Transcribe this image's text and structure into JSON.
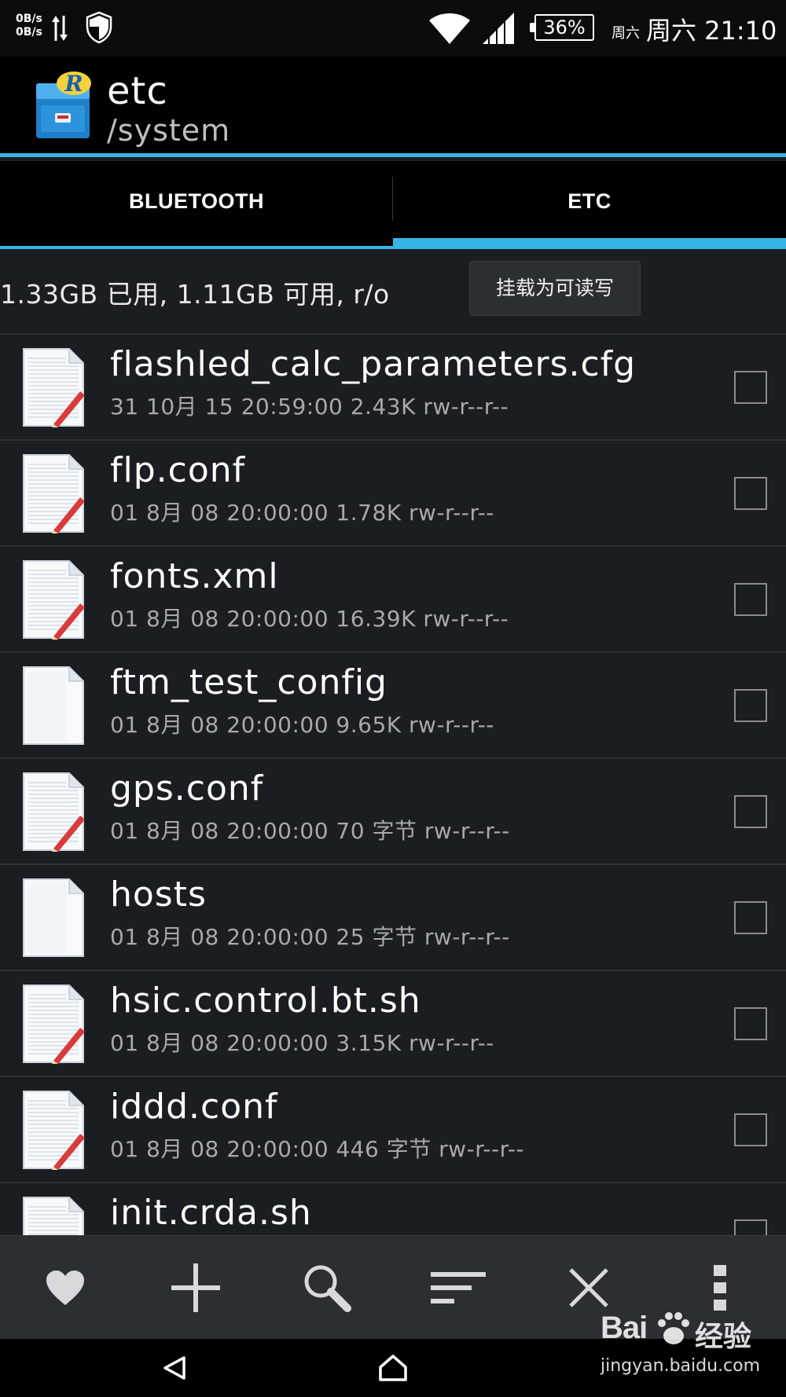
{
  "status_bar": {
    "net_speed_up": "0B/s",
    "net_speed_down": "0B/s",
    "battery": "36%",
    "day_small": "周六",
    "day_time": "周六 21:10"
  },
  "app": {
    "title": "etc",
    "subtitle": "/system",
    "accent_color": "#33b5e5"
  },
  "tabs": [
    {
      "label": "BLUETOOTH",
      "selected": false
    },
    {
      "label": "ETC",
      "selected": true
    }
  ],
  "storage": {
    "info": "1.33GB 已用, 1.11GB 可用, r/o",
    "mount_button": "挂载为可读写"
  },
  "files": [
    {
      "name": "flashled_calc_parameters.cfg",
      "meta": "31 10月 15 20:59:00 2.43K rw-r--r--",
      "icon": "text-file-icon"
    },
    {
      "name": "flp.conf",
      "meta": "01 8月 08 20:00:00 1.78K rw-r--r--",
      "icon": "text-file-icon"
    },
    {
      "name": "fonts.xml",
      "meta": "01 8月 08 20:00:00 16.39K rw-r--r--",
      "icon": "text-file-icon"
    },
    {
      "name": "ftm_test_config",
      "meta": "01 8月 08 20:00:00 9.65K rw-r--r--",
      "icon": "blank-file-icon"
    },
    {
      "name": "gps.conf",
      "meta": "01 8月 08 20:00:00 70 字节 rw-r--r--",
      "icon": "text-file-icon"
    },
    {
      "name": "hosts",
      "meta": "01 8月 08 20:00:00 25 字节 rw-r--r--",
      "icon": "blank-file-icon"
    },
    {
      "name": "hsic.control.bt.sh",
      "meta": "01 8月 08 20:00:00 3.15K rw-r--r--",
      "icon": "text-file-icon"
    },
    {
      "name": "iddd.conf",
      "meta": "01 8月 08 20:00:00 446 字节 rw-r--r--",
      "icon": "text-file-icon"
    },
    {
      "name": "init.crda.sh",
      "meta": "",
      "icon": "text-file-icon"
    }
  ],
  "toolbar": [
    "heart-icon",
    "plus-icon",
    "search-icon",
    "sort-icon",
    "close-icon",
    "overflow-menu-icon"
  ],
  "watermark": {
    "brand": "Bai",
    "brand_cn": "经验",
    "url": "jingyan.baidu.com"
  }
}
